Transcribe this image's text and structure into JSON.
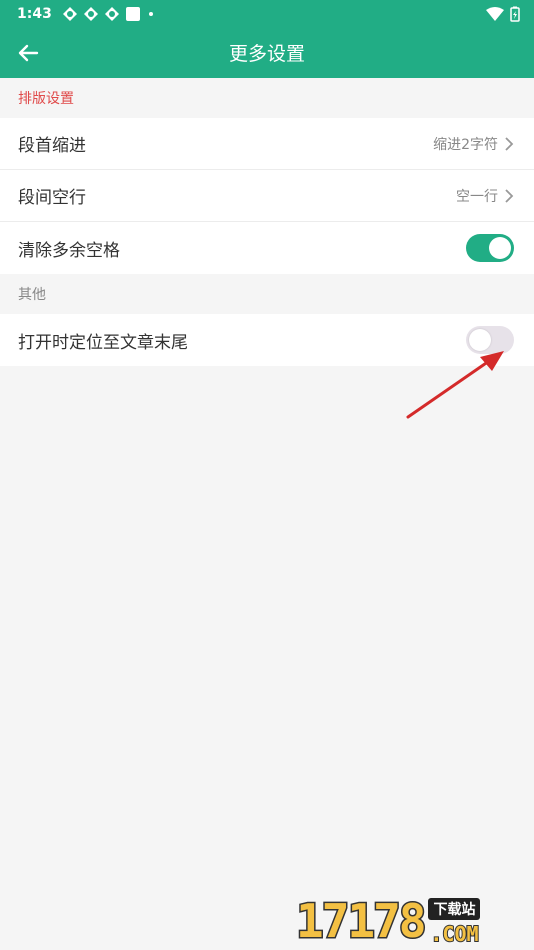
{
  "status_bar": {
    "time": "1:43",
    "icons": [
      "sync-icon",
      "sync-icon",
      "sync-icon",
      "square-icon",
      "dot-icon"
    ],
    "right_icons": [
      "wifi-icon",
      "battery-icon"
    ]
  },
  "toolbar": {
    "title": "更多设置",
    "back_icon": "back-arrow-icon"
  },
  "sections": {
    "layout": {
      "header": "排版设置",
      "items": [
        {
          "label": "段首缩进",
          "value": "缩进2字符"
        },
        {
          "label": "段间空行",
          "value": "空一行"
        },
        {
          "label": "清除多余空格",
          "toggle": true
        }
      ]
    },
    "other": {
      "header": "其他",
      "items": [
        {
          "label": "打开时定位至文章末尾",
          "toggle": false
        }
      ]
    }
  },
  "watermark": {
    "number": "17178",
    "tag": "下载站",
    "suffix": ".COM"
  },
  "colors": {
    "primary": "#21ad85",
    "section_red": "#e04a4a",
    "annotation_arrow": "#d42a2a"
  }
}
